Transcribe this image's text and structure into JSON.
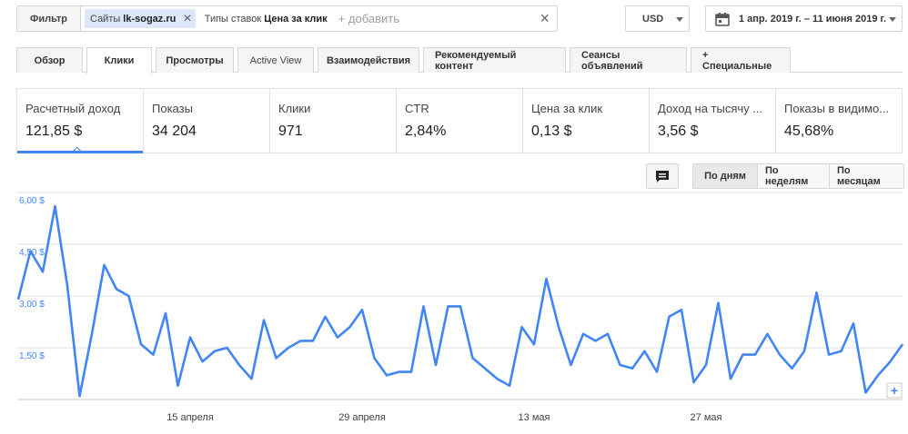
{
  "filter": {
    "button_label": "Фильтр",
    "chips": [
      {
        "name": "Сайты",
        "value": "lk-sogaz.ru"
      },
      {
        "name": "Типы ставок",
        "value": "Цена за клик"
      }
    ],
    "add_placeholder": "+ добавить",
    "clear_symbol": "×"
  },
  "currency": "USD",
  "date_range": "1 апр. 2019 г. – 11 июня 2019 г.",
  "tabs": [
    {
      "label": "Обзор"
    },
    {
      "label": "Клики"
    },
    {
      "label": "Просмотры"
    },
    {
      "label": "Active View"
    },
    {
      "label": "Взаимодействия"
    },
    {
      "label": "Рекомендуемый контент"
    },
    {
      "label": "Сеансы объявлений"
    },
    {
      "label": "+  Специальные"
    }
  ],
  "selected_tab": "Клики",
  "scorecards": [
    {
      "title": "Расчетный доход",
      "value": "121,85 $"
    },
    {
      "title": "Показы",
      "value": "34 204"
    },
    {
      "title": "Клики",
      "value": "971"
    },
    {
      "title": "CTR",
      "value": "2,84%"
    },
    {
      "title": "Цена за клик",
      "value": "0,13 $"
    },
    {
      "title": "Доход на тысячу ...",
      "value": "3,56 $"
    },
    {
      "title": "Показы в видимо...",
      "value": "45,68%"
    }
  ],
  "selected_scorecard": "Расчетный доход",
  "icons": {
    "comment": "comment-icon",
    "calendar": "calendar-icon",
    "zoom": "plus-icon"
  },
  "period_buttons": [
    {
      "label": "По дням"
    },
    {
      "label": "По неделям"
    },
    {
      "label": "По месяцам"
    }
  ],
  "selected_period": "По дням",
  "colors": {
    "accent": "#4285f4",
    "line": "#4285f4",
    "grid": "#e0e0e0"
  },
  "chart_data": {
    "type": "line",
    "title": "",
    "xlabel": "",
    "ylabel": "",
    "y_ticks": [
      "1,50 $",
      "3,00 $",
      "4,50 $",
      "6,00 $"
    ],
    "ylim": [
      0,
      6
    ],
    "x_ticks": [
      "15 апреля",
      "29 апреля",
      "13 мая",
      "27 мая"
    ],
    "x_start": "1 апреля",
    "grid": true,
    "series": [
      {
        "values": [
          2.9,
          4.3,
          3.7,
          5.6,
          3.3,
          0.1,
          1.9,
          3.9,
          3.2,
          3.0,
          1.6,
          1.3,
          2.5,
          0.4,
          1.8,
          1.1,
          1.4,
          1.5,
          1.0,
          0.6,
          2.3,
          1.2,
          1.5,
          1.7,
          1.7,
          2.4,
          1.8,
          2.1,
          2.6,
          1.2,
          0.7,
          0.8,
          0.8,
          2.7,
          1.0,
          2.7,
          2.7,
          1.2,
          0.9,
          0.6,
          0.4,
          2.1,
          1.6,
          3.5,
          2.1,
          1.0,
          1.9,
          1.7,
          1.9,
          1.0,
          0.9,
          1.4,
          0.8,
          2.4,
          2.6,
          0.5,
          1.0,
          2.8,
          0.6,
          1.3,
          1.3,
          1.9,
          1.3,
          0.9,
          1.4,
          3.1,
          1.3,
          1.4,
          2.2,
          0.2,
          0.7,
          1.1,
          1.6
        ]
      }
    ]
  }
}
